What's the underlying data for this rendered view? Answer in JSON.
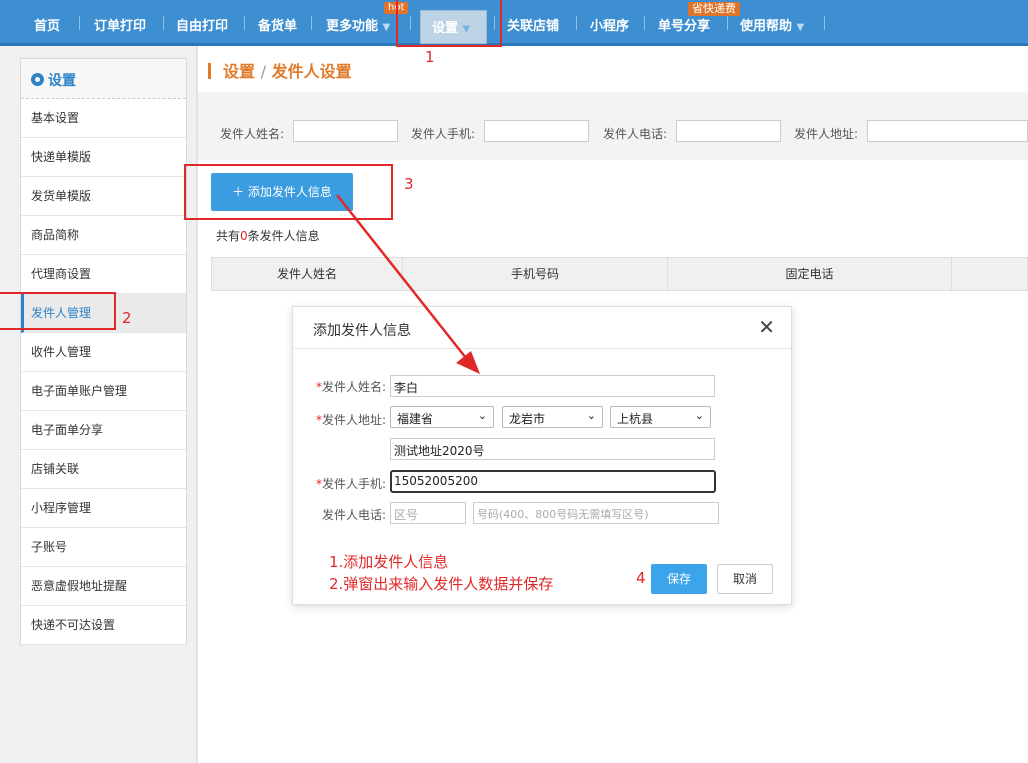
{
  "topnav": {
    "items": [
      "首页",
      "订单打印",
      "自由打印",
      "备货单",
      "更多功能",
      "设置",
      "关联店铺",
      "小程序",
      "单号分享",
      "使用帮助"
    ],
    "hot_badge": "hot",
    "save_badge": "省快递费"
  },
  "sidebar": {
    "title": "设置",
    "items": [
      "基本设置",
      "快递单模版",
      "发货单模版",
      "商品简称",
      "代理商设置",
      "发件人管理",
      "收件人管理",
      "电子面单账户管理",
      "电子面单分享",
      "店铺关联",
      "小程序管理",
      "子账号",
      "恶意虚假地址提醒",
      "快递不可达设置"
    ],
    "active_index": 5
  },
  "breadcrumb": {
    "parent": "设置",
    "sep": "/",
    "current": "发件人设置"
  },
  "filters": {
    "name_label": "发件人姓名:",
    "mobile_label": "发件人手机:",
    "phone_label": "发件人电话:",
    "address_label": "发件人地址:"
  },
  "add_button": "＋ 添加发件人信息",
  "count": {
    "prefix": "共有",
    "num": "0",
    "suffix": "条发件人信息"
  },
  "table": {
    "headers": [
      "发件人姓名",
      "手机号码",
      "固定电话"
    ]
  },
  "modal": {
    "title": "添加发件人信息",
    "name_label": "发件人姓名:",
    "name_value": "李白",
    "address_label": "发件人地址:",
    "province": "福建省",
    "city": "龙岩市",
    "county": "上杭县",
    "detail_address": "测试地址2020号",
    "mobile_label": "发件人手机:",
    "mobile_value": "15052005200",
    "phone_label": "发件人电话:",
    "area_placeholder": "区号",
    "number_placeholder": "号码(400、800号码无需填写区号)",
    "save": "保存",
    "cancel": "取消"
  },
  "annotations": {
    "n1": "1",
    "n2": "2",
    "n3": "3",
    "n4": "4",
    "note_line1": "1.添加发件人信息",
    "note_line2": "2.弹窗出来输入发件人数据并保存"
  },
  "colors": {
    "nav_bg": "#3d8fd1",
    "accent": "#2d83c8",
    "orange": "#e07b2c",
    "annotation_red": "#e02828",
    "button_blue": "#3b9de0"
  }
}
